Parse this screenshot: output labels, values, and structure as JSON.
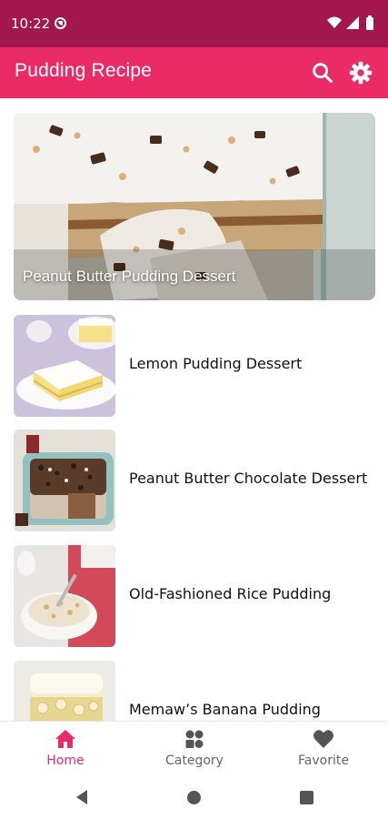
{
  "status_bar": {
    "time": "10:22"
  },
  "app_bar": {
    "title": "Pudding Recipe"
  },
  "featured": {
    "title": "Peanut Butter Pudding Dessert"
  },
  "recipes": [
    {
      "title": "Lemon Pudding Dessert"
    },
    {
      "title": "Peanut Butter Chocolate Dessert"
    },
    {
      "title": "Old-Fashioned Rice Pudding"
    },
    {
      "title": "Memaw’s Banana Pudding"
    }
  ],
  "bottom_nav": {
    "items": [
      {
        "label": "Home",
        "icon": "home-icon",
        "active": true
      },
      {
        "label": "Category",
        "icon": "grid-icon",
        "active": false
      },
      {
        "label": "Favorite",
        "icon": "heart-icon",
        "active": false
      }
    ]
  },
  "colors": {
    "status_bar": "#a3174f",
    "app_bar": "#ea2b66",
    "accent": "#ea2b66",
    "inactive": "#666666"
  }
}
